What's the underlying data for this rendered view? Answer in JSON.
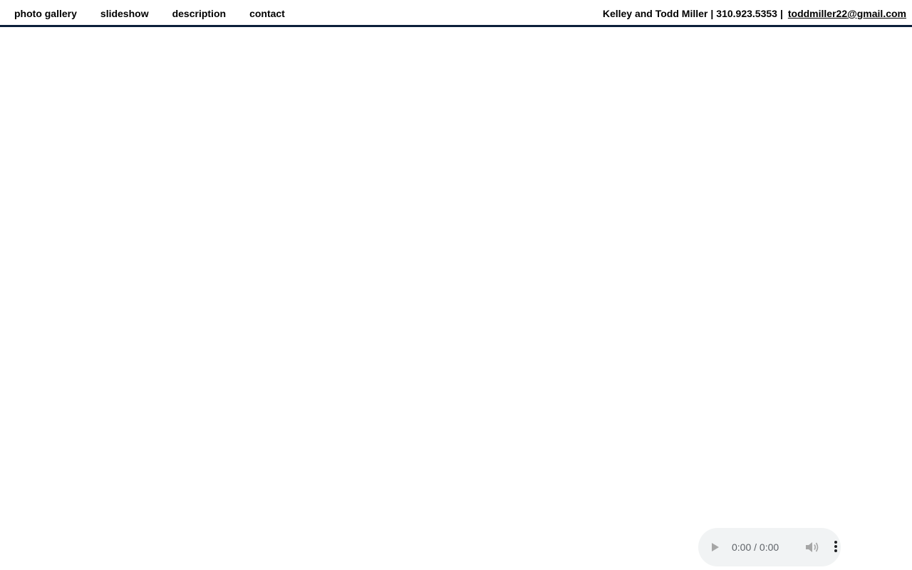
{
  "nav": {
    "items": [
      {
        "label": "photo gallery"
      },
      {
        "label": "slideshow"
      },
      {
        "label": "description"
      },
      {
        "label": "contact"
      }
    ]
  },
  "contact": {
    "names": "Kelley and Todd Miller",
    "separator": "|",
    "phone": "310.923.5353",
    "email": "toddmiller22@gmail.com"
  },
  "audio": {
    "time": "0:00 / 0:00",
    "play_icon": "play-icon",
    "volume_icon": "volume-icon",
    "menu_icon": "more-vert-icon"
  },
  "colors": {
    "header_border": "#0b1f3a",
    "player_bg": "#f1f3f4"
  }
}
